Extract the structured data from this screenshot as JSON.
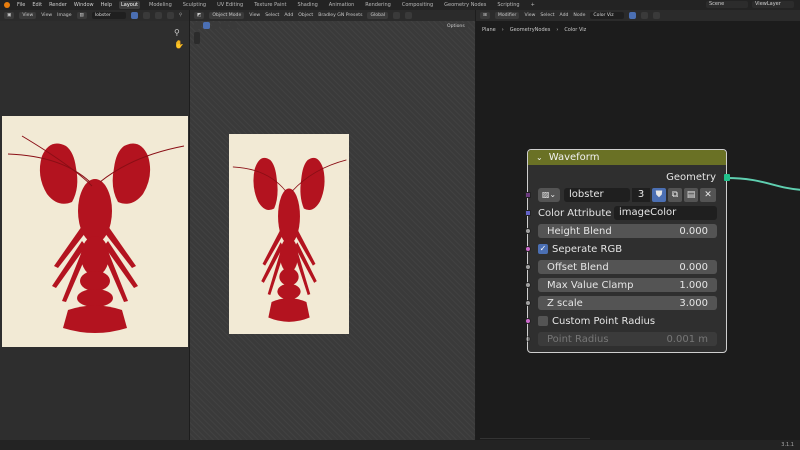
{
  "menubar": {
    "menus": [
      "File",
      "Edit",
      "Render",
      "Window",
      "Help"
    ],
    "workspaces": [
      "Layout",
      "Modeling",
      "Sculpting",
      "UV Editing",
      "Texture Paint",
      "Shading",
      "Animation",
      "Rendering",
      "Compositing",
      "Geometry Nodes",
      "Scripting"
    ],
    "active_workspace": "Layout",
    "add_tab": "+",
    "scene_name": "Scene",
    "view_layer": "ViewLayer"
  },
  "image_editor": {
    "view_label": "View",
    "menus": [
      "View",
      "Image"
    ],
    "image_name": "lobster"
  },
  "viewport": {
    "mode": "Object Mode",
    "menus": [
      "View",
      "Select",
      "Add",
      "Object",
      "Bradley GN Presets"
    ],
    "orientation": "Global",
    "options_label": "Options"
  },
  "node_editor": {
    "editor_type": "Modifier",
    "menus": [
      "View",
      "Select",
      "Add",
      "Node"
    ],
    "node_group": "Color Viz",
    "breadcrumb": [
      "Plane",
      "GeometryNodes",
      "Color Viz"
    ]
  },
  "node": {
    "title": "Waveform",
    "output_label": "Geometry",
    "image": {
      "name": "lobster",
      "users": "3"
    },
    "color_attribute_label": "Color Attribute",
    "color_attribute_value": "imageColor",
    "height_blend": {
      "label": "Height Blend",
      "value": "0.000"
    },
    "separate_rgb": {
      "label": "Seperate RGB",
      "checked": true
    },
    "offset_blend": {
      "label": "Offset Blend",
      "value": "0.000"
    },
    "max_value_clamp": {
      "label": "Max Value Clamp",
      "value": "1.000"
    },
    "z_scale": {
      "label": "Z scale",
      "value": "3.000"
    },
    "custom_point_radius": {
      "label": "Custom Point Radius",
      "checked": false
    },
    "point_radius": {
      "label": "Point Radius",
      "value": "0.001 m"
    }
  },
  "status": {
    "version": "3.1.1"
  },
  "colors": {
    "node_header": "#6a7125",
    "accent_blue": "#4b6fb3",
    "lobster_red": "#b3131f",
    "paper": "#f2ead5"
  }
}
